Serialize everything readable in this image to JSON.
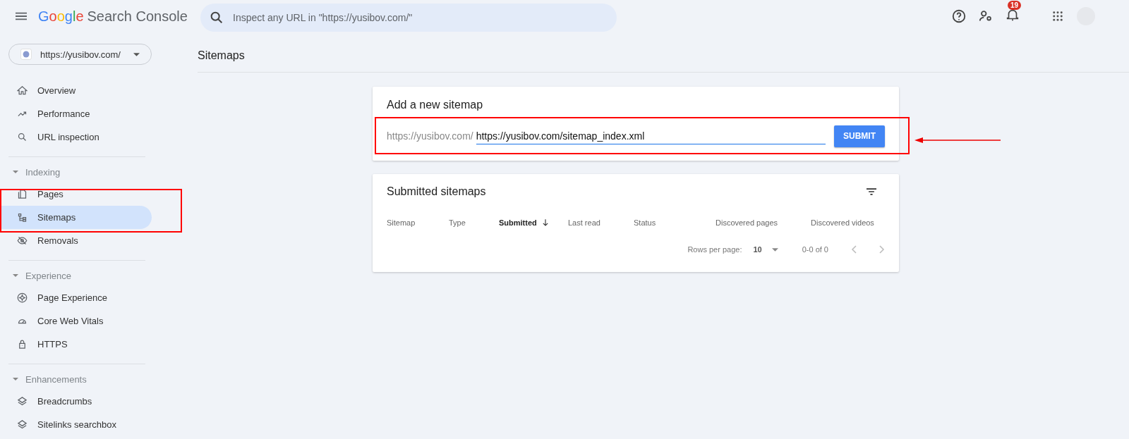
{
  "header": {
    "logo_letters": [
      "G",
      "o",
      "o",
      "g",
      "l",
      "e"
    ],
    "product": "Search Console",
    "search": {
      "placeholder": "Inspect any URL in \"https://yusibov.com/\""
    },
    "notifications": "19"
  },
  "property": {
    "label": "https://yusibov.com/"
  },
  "sidebar": {
    "sections": [
      {
        "items": [
          {
            "label": "Overview",
            "selected": false
          },
          {
            "label": "Performance",
            "selected": false
          },
          {
            "label": "URL inspection",
            "selected": false
          }
        ]
      },
      {
        "header": "Indexing",
        "expanded": true,
        "items": [
          {
            "label": "Pages",
            "selected": false
          },
          {
            "label": "Sitemaps",
            "selected": true
          },
          {
            "label": "Removals",
            "selected": false
          }
        ]
      },
      {
        "header": "Experience",
        "expanded": true,
        "items": [
          {
            "label": "Page Experience",
            "selected": false
          },
          {
            "label": "Core Web Vitals",
            "selected": false
          },
          {
            "label": "HTTPS",
            "selected": false
          }
        ]
      },
      {
        "header": "Enhancements",
        "expanded": true,
        "items": [
          {
            "label": "Breadcrumbs",
            "selected": false
          },
          {
            "label": "Sitelinks searchbox",
            "selected": false
          }
        ]
      }
    ]
  },
  "page_title": "Sitemaps",
  "add_sitemap": {
    "title": "Add a new sitemap",
    "prefix": "https://yusibov.com/",
    "value": "https://yusibov.com/sitemap_index.xml",
    "button": "SUBMIT"
  },
  "submitted_sitemaps": {
    "title": "Submitted sitemaps",
    "columns": [
      {
        "label": "Sitemap",
        "sorted": false
      },
      {
        "label": "Type",
        "sorted": false
      },
      {
        "label": "Submitted",
        "sorted": true
      },
      {
        "label": "Last read",
        "sorted": false
      },
      {
        "label": "Status",
        "sorted": false
      },
      {
        "label": "Discovered pages",
        "sorted": false
      },
      {
        "label": "Discovered videos",
        "sorted": false
      }
    ],
    "pagination": {
      "rows_label": "Rows per page:",
      "rows_value": "10",
      "range": "0-0 of 0"
    }
  }
}
